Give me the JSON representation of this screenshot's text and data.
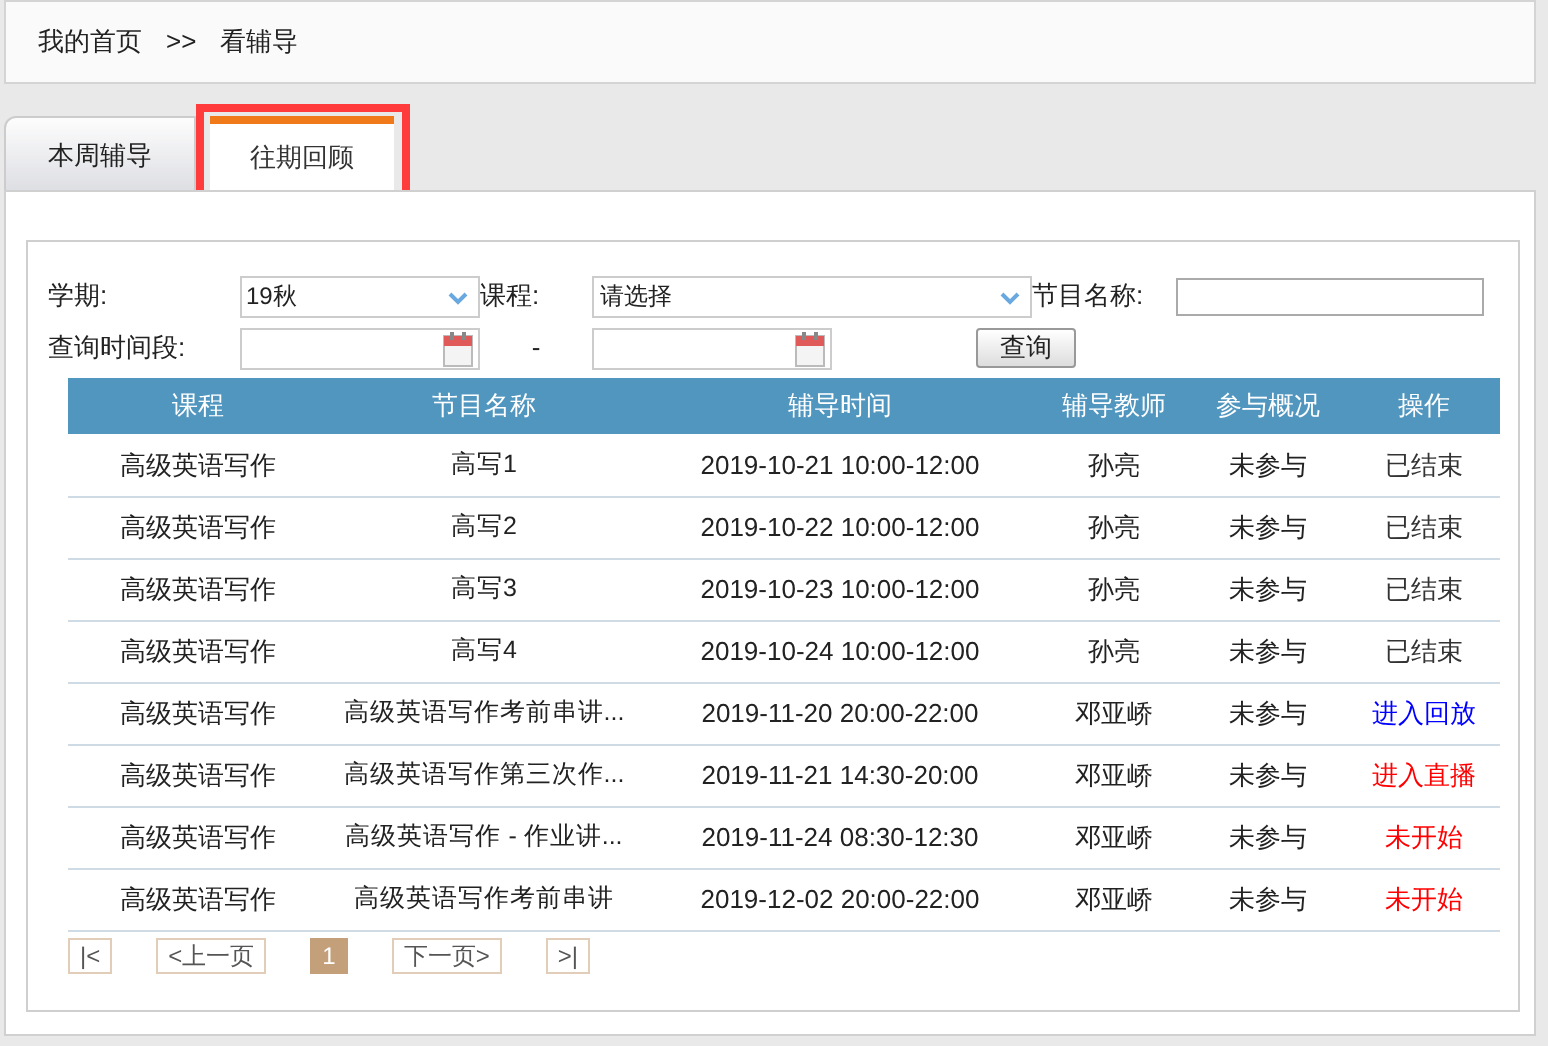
{
  "breadcrumb": [
    "我的首页",
    ">>",
    "看辅导"
  ],
  "tabs": [
    {
      "label": "本周辅导",
      "selected": false,
      "highlighted": false
    },
    {
      "label": "往期回顾",
      "selected": true,
      "highlighted": true
    }
  ],
  "filters": {
    "term_label": "学期:",
    "term_value": "19秋",
    "course_label": "课程:",
    "course_value": "请选择",
    "program_label": "节目名称:",
    "period_label": "查询时间段:",
    "period_separator": "-",
    "search_button": "查询"
  },
  "table": {
    "columns": [
      "课程",
      "节目名称",
      "辅导时间",
      "辅导教师",
      "参与概况",
      "操作"
    ],
    "rows": [
      {
        "course": "高级英语写作",
        "program": "高写1",
        "time": "2019-10-21 10:00-12:00",
        "teacher": "孙亮",
        "participation": "未参与",
        "action": "已结束",
        "color": "#333333"
      },
      {
        "course": "高级英语写作",
        "program": "高写2",
        "time": "2019-10-22 10:00-12:00",
        "teacher": "孙亮",
        "participation": "未参与",
        "action": "已结束",
        "color": "#333333"
      },
      {
        "course": "高级英语写作",
        "program": "高写3",
        "time": "2019-10-23 10:00-12:00",
        "teacher": "孙亮",
        "participation": "未参与",
        "action": "已结束",
        "color": "#333333"
      },
      {
        "course": "高级英语写作",
        "program": "高写4",
        "time": "2019-10-24 10:00-12:00",
        "teacher": "孙亮",
        "participation": "未参与",
        "action": "已结束",
        "color": "#333333"
      },
      {
        "course": "高级英语写作",
        "program": "高级英语写作考前串讲...",
        "time": "2019-11-20 20:00-22:00",
        "teacher": "邓亚峤",
        "participation": "未参与",
        "action": "进入回放",
        "color": "#0000ff"
      },
      {
        "course": "高级英语写作",
        "program": "高级英语写作第三次作...",
        "time": "2019-11-21 14:30-20:00",
        "teacher": "邓亚峤",
        "participation": "未参与",
        "action": "进入直播",
        "color": "#ff0000"
      },
      {
        "course": "高级英语写作",
        "program": "高级英语写作 - 作业讲...",
        "time": "2019-11-24 08:30-12:30",
        "teacher": "邓亚峤",
        "participation": "未参与",
        "action": "未开始",
        "color": "#ff0000"
      },
      {
        "course": "高级英语写作",
        "program": "高级英语写作考前串讲",
        "time": "2019-12-02 20:00-22:00",
        "teacher": "邓亚峤",
        "participation": "未参与",
        "action": "未开始",
        "color": "#ff0000"
      }
    ]
  },
  "pager": [
    {
      "label": "|<",
      "selected": false
    },
    {
      "label": "<上一页",
      "selected": false
    },
    {
      "label": "1",
      "selected": true
    },
    {
      "label": "下一页>",
      "selected": false
    },
    {
      "label": ">|",
      "selected": false
    }
  ]
}
